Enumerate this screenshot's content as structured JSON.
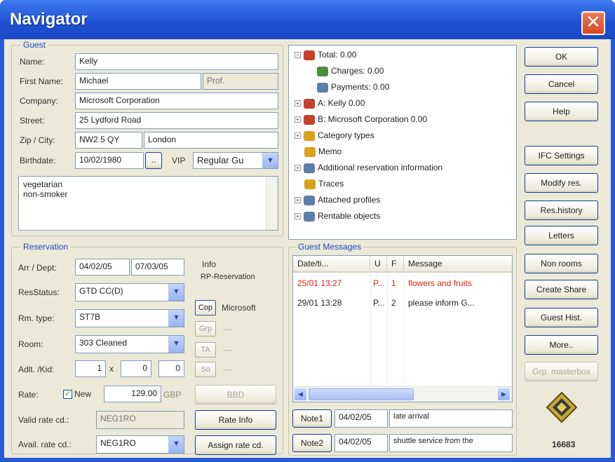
{
  "window": {
    "title": "Navigator"
  },
  "guest": {
    "legend": "Guest",
    "name_label": "Name:",
    "name_value": "Kelly",
    "first_name_label": "First Name:",
    "first_name_value": "Michael",
    "title_value": "Prof.",
    "company_label": "Company:",
    "company_value": "Microsoft Corporation",
    "street_label": "Street:",
    "street_value": "25 Lydford Road",
    "zip_label": "Zip / City:",
    "zip_value": "NW2 5 QY",
    "city_value": "London",
    "birthdate_label": "Birthdate:",
    "birthdate_value": "10/02/1980",
    "ellipsis_button": "..",
    "vip_label": "VIP",
    "vip_value": "Regular Gu",
    "notes_lines": [
      "vegetarian",
      "non-smoker"
    ]
  },
  "reservation": {
    "legend": "Reservation",
    "arr_dept_label": "Arr / Dept:",
    "arrival_value": "04/02/05",
    "departure_value": "07/03/05",
    "resstatus_label": "ResStatus:",
    "resstatus_value": "GTD CC(D)",
    "rm_type_label": "Rm. type:",
    "rm_type_value": "ST7B",
    "room_label": "Room:",
    "room_value": "303 Cleaned",
    "adlt_kid_label": "Adlt. /Kid:",
    "adults_value": "1",
    "x_sign": "x",
    "kids_value": "0",
    "kids2_value": "0",
    "rate_label": "Rate:",
    "new_label": "New",
    "rate_value": "129.00",
    "currency": "GBP",
    "valid_rate_label": "Valid rate cd.:",
    "valid_rate_value": "NEG1RO",
    "avail_rate_label": "Avail. rate cd.:",
    "avail_rate_value": "NEG1RO"
  },
  "info": {
    "heading": "Info",
    "rp_reservation": "RP-Reservation",
    "rows": [
      {
        "button": "Cop",
        "text": "Microsoft",
        "enabled": true
      },
      {
        "button": "Grp",
        "text": "---",
        "enabled": false
      },
      {
        "button": "TA",
        "text": "---",
        "enabled": false
      },
      {
        "button": "So",
        "text": "---",
        "enabled": false
      }
    ],
    "bbd_button": "BBD",
    "rate_info_button": "Rate Info",
    "assign_rate_button": "Assign rate cd."
  },
  "tree": {
    "items": [
      {
        "expander": "−",
        "label": "Total: 0.00"
      },
      {
        "expander": "",
        "label": "Charges: 0.00"
      },
      {
        "expander": "",
        "label": "Payments: 0.00"
      },
      {
        "expander": "+",
        "label": "A: Kelly 0.00"
      },
      {
        "expander": "+",
        "label": "B: Microsoft Corporation 0.00"
      },
      {
        "expander": "+",
        "label": "Category types"
      },
      {
        "expander": "",
        "label": "Memo"
      },
      {
        "expander": "+",
        "label": "Additional reservation information"
      },
      {
        "expander": "",
        "label": "Traces"
      },
      {
        "expander": "+",
        "label": "Attached profiles"
      },
      {
        "expander": "+",
        "label": "Rentable objects"
      }
    ]
  },
  "messages": {
    "legend": "Guest Messages",
    "columns": [
      "Date/ti...",
      "U",
      "F",
      "Message"
    ],
    "rows": [
      {
        "date": "25/01 13:27",
        "user": "P...",
        "flag": "1",
        "message": "flowers and fruits",
        "color": "#e8200f"
      },
      {
        "date": "29/01 13:28",
        "user": "P...",
        "flag": "2",
        "message": "please inform G...",
        "color": "#222222"
      }
    ],
    "notes": [
      {
        "button": "Note1",
        "date": "04/02/05",
        "text": "late arrival"
      },
      {
        "button": "Note2",
        "date": "04/02/05",
        "text": "shuttle service from the"
      }
    ]
  },
  "buttons": {
    "ok": "OK",
    "cancel": "Cancel",
    "help": "Help",
    "ifc": "IFC Settings",
    "modify": "Modify res.",
    "res_history": "Res.history",
    "letters": "Letters",
    "non_rooms": "Non rooms",
    "create_share": "Create Share",
    "guest_hist": "Guest Hist.",
    "more": "More..",
    "grp_master": "Grp. masterbox"
  },
  "footer": {
    "number": "16683"
  },
  "colors": {
    "title_bar": "#2a5bd6",
    "dialog_bg": "#ece9d8",
    "legend_text": "#2147c8",
    "alert_text": "#e8200f"
  }
}
